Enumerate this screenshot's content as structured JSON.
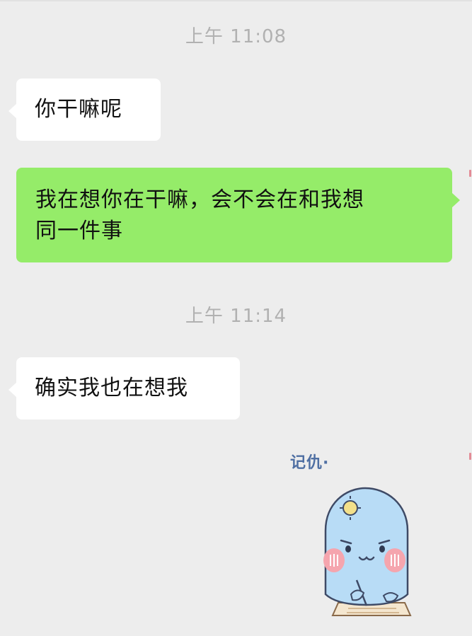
{
  "chat": {
    "messages": [
      {
        "type": "timestamp",
        "text": "上午 11:08"
      },
      {
        "type": "incoming",
        "text": "你干嘛呢"
      },
      {
        "type": "outgoing",
        "line1": "我在想你在干嘛，会不会在和我想",
        "line2": "同一件事"
      },
      {
        "type": "timestamp",
        "text": "上午 11:14"
      },
      {
        "type": "incoming",
        "text": "确实我也在想我"
      }
    ],
    "sticker": {
      "caption": "记仇·",
      "icon": "cartoon-ghost-holding-grudge-sticker"
    }
  },
  "colors": {
    "background": "#ededed",
    "incoming_bubble": "#ffffff",
    "outgoing_bubble": "#95ec69",
    "timestamp": "#b1b1b1",
    "text": "#111111"
  }
}
